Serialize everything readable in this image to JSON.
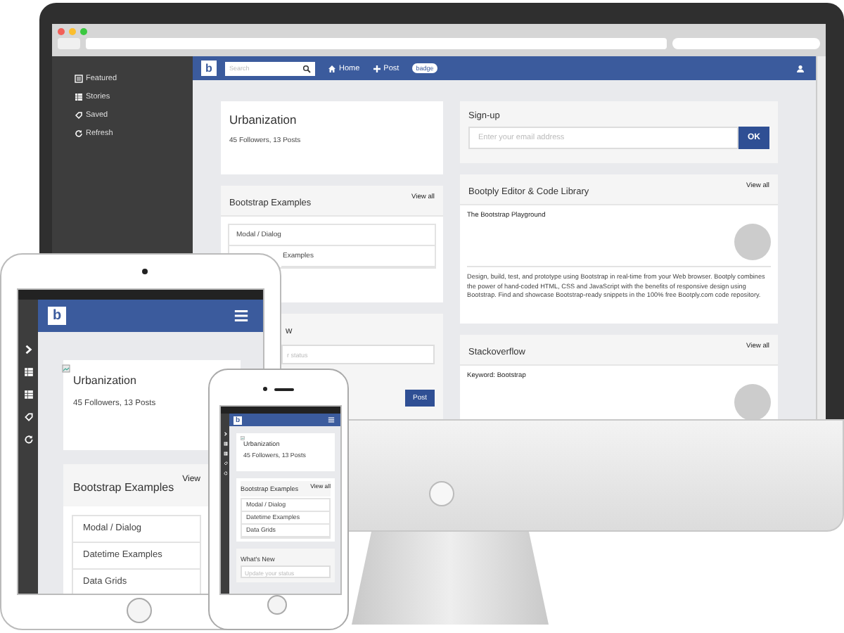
{
  "monitor": {
    "sidebar": [
      {
        "label": "Featured"
      },
      {
        "label": "Stories"
      },
      {
        "label": "Saved"
      },
      {
        "label": "Refresh"
      }
    ],
    "navbar": {
      "logo": "b",
      "search_placeholder": "Search",
      "links": [
        {
          "label": "Home"
        },
        {
          "label": "Post"
        }
      ],
      "badge": "badge"
    },
    "profile_card": {
      "title": "Urbanization",
      "stats": "45 Followers, 13 Posts"
    },
    "examples_card": {
      "title": "Bootstrap Examples",
      "link": "View all",
      "items": [
        "Modal / Dialog",
        "Examples"
      ]
    },
    "status_card": {
      "title": "w",
      "placeholder": "r status",
      "button": "Post"
    },
    "signup": {
      "title": "Sign-up",
      "placeholder": "Enter your email address",
      "button": "OK"
    },
    "feeds": [
      {
        "title": "Bootply Editor & Code Library",
        "link": "View all",
        "subtitle": "The Bootstrap Playground",
        "text": "Design, build, test, and prototype using Bootstrap in real-time from your Web browser. Bootply combines the power of hand-coded HTML, CSS and JavaScript with the benefits of responsive design using Bootstrap. Find and showcase Bootstrap-ready snippets in the 100% free Bootply.com code repository."
      },
      {
        "title": "Stackoverflow",
        "link": "View all",
        "subtitle": "Keyword: Bootstrap"
      }
    ]
  },
  "tablet": {
    "logo": "b",
    "profile_card": {
      "title": "Urbanization",
      "stats": "45 Followers, 13 Posts"
    },
    "examples_card": {
      "title": "Bootstrap Examples",
      "link": "View",
      "items": [
        "Modal / Dialog",
        "Datetime Examples",
        "Data Grids"
      ]
    }
  },
  "phone": {
    "logo": "b",
    "profile_card": {
      "title": "Urbanization",
      "stats": "45 Followers, 13 Posts"
    },
    "examples_card": {
      "title": "Bootstrap Examples",
      "link": "View all",
      "items": [
        "Modal / Dialog",
        "Datetime Examples",
        "Data Grids"
      ]
    },
    "status_card": {
      "title": "What's New",
      "placeholder": "Update your status"
    }
  }
}
